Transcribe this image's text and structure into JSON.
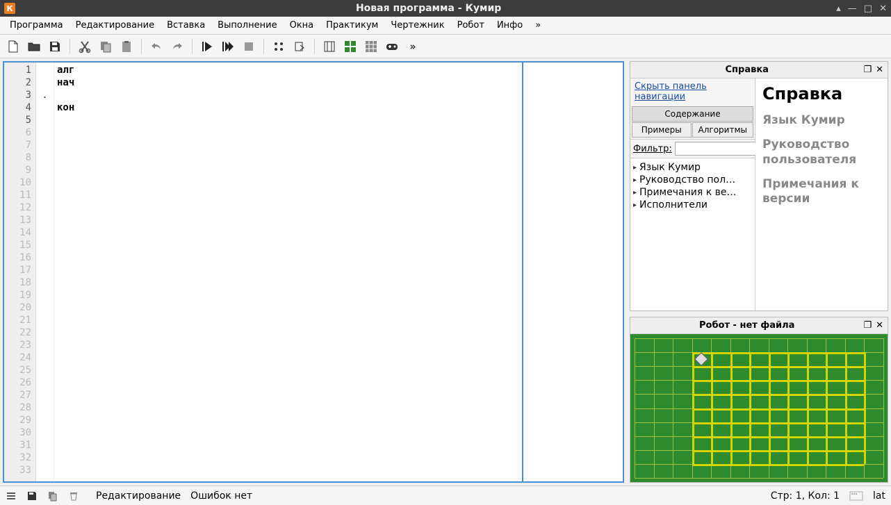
{
  "window": {
    "app_icon_letter": "К",
    "title": "Новая программа - Кумир"
  },
  "menu": {
    "items": [
      "Программа",
      "Редактирование",
      "Вставка",
      "Выполнение",
      "Окна",
      "Практикум",
      "Чертежник",
      "Робот",
      "Инфо",
      "»"
    ]
  },
  "toolbar": {
    "overflow": "»"
  },
  "editor": {
    "total_lines": 33,
    "code_lines": [
      {
        "n": 1,
        "text": "алг",
        "indent": ""
      },
      {
        "n": 2,
        "text": "нач",
        "indent": ""
      },
      {
        "n": 3,
        "text": "",
        "indent": "."
      },
      {
        "n": 4,
        "text": "кон",
        "indent": ""
      },
      {
        "n": 5,
        "text": "",
        "indent": ""
      }
    ]
  },
  "help_panel": {
    "title": "Справка",
    "hide_nav": "Скрыть панель навигации",
    "tabs": {
      "contents": "Содержание",
      "examples": "Примеры",
      "algorithms": "Алгоритмы"
    },
    "filter_label": "Фильтр:",
    "filter_value": "",
    "tree": [
      "Язык Кумир",
      "Руководство пол…",
      "Примечания к ве…",
      "Исполнители"
    ],
    "content": {
      "h1": "Справка",
      "sections": [
        "Язык Кумир",
        "Руководство пользователя",
        "Примечания к версии"
      ]
    }
  },
  "robot_panel": {
    "title": "Робот - нет файла"
  },
  "statusbar": {
    "mode": "Редактирование",
    "errors": "Ошибок нет",
    "position": "Стр: 1, Кол: 1",
    "lang": "lat"
  }
}
